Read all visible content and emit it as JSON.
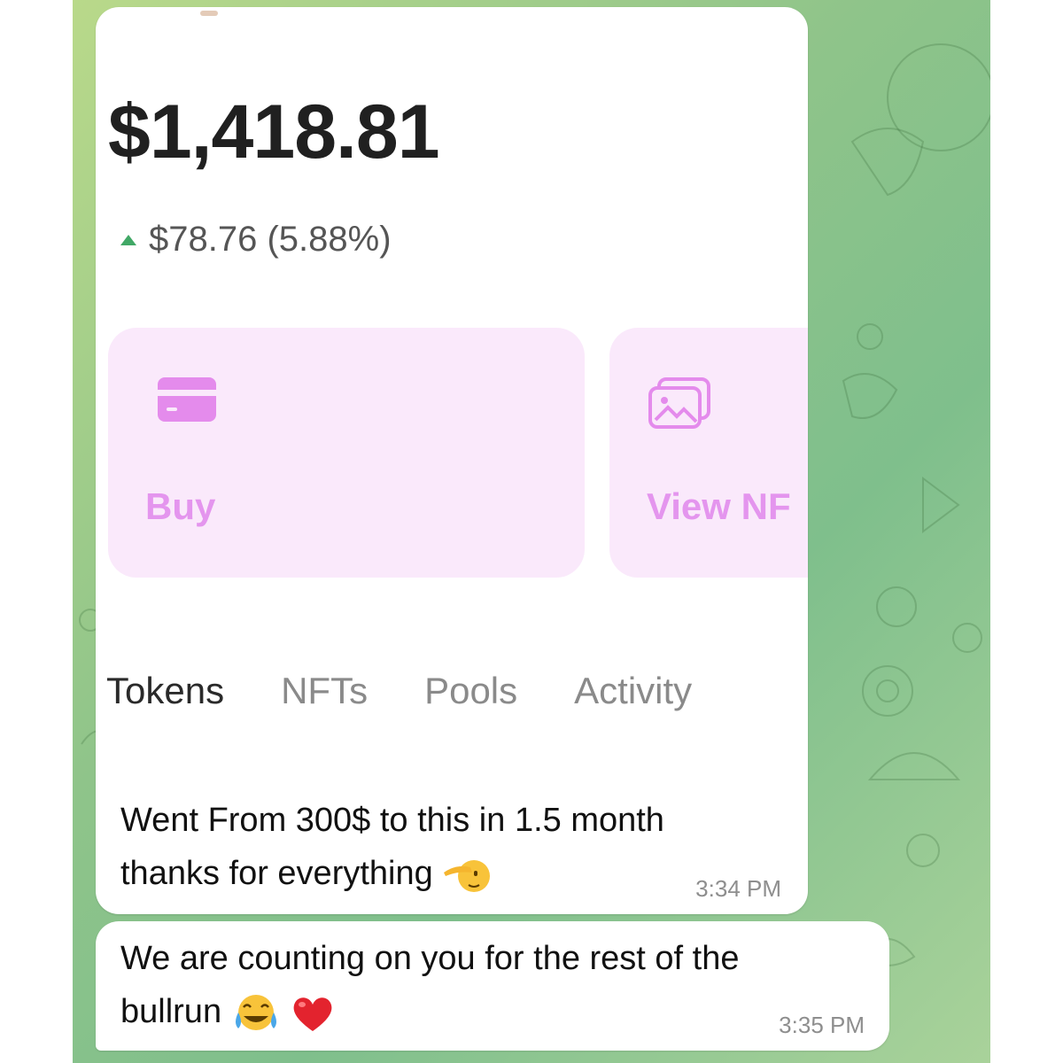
{
  "wallet": {
    "balance": "$1,418.81",
    "change": "$78.76 (5.88%)",
    "colors": {
      "accent": "#e495ee",
      "card_bg": "#fae9fb",
      "up": "#41a866"
    },
    "actions": [
      {
        "label": "Buy",
        "icon": "credit-card-icon"
      },
      {
        "label": "View NF",
        "icon": "images-icon"
      }
    ],
    "tabs": [
      {
        "label": "Tokens",
        "active": true
      },
      {
        "label": "NFTs",
        "active": false
      },
      {
        "label": "Pools",
        "active": false
      },
      {
        "label": "Activity",
        "active": false
      }
    ]
  },
  "messages": [
    {
      "text_line1": "Went  From 300$ to this in 1.5 month",
      "text_line2": "thanks for everything",
      "emoji": "saluting-face-icon",
      "time": "3:34 PM"
    },
    {
      "text_line1": "We are counting on you for the rest of the",
      "text_line2": "bullrun",
      "emojis": [
        "tears-of-joy-icon",
        "red-heart-icon"
      ],
      "time": "3:35 PM"
    }
  ]
}
